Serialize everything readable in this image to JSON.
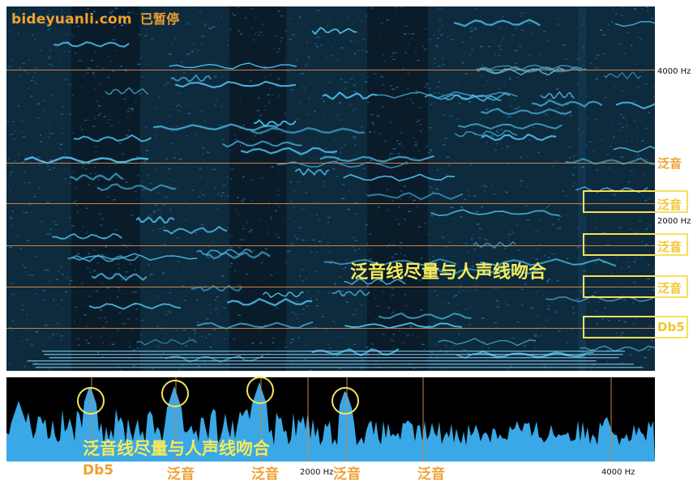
{
  "watermark": {
    "site": "bideyuanli.com",
    "status": "已暂停"
  },
  "spectrogram": {
    "freq_labels": {
      "f4000": "4000 Hz",
      "f2000": "2000 Hz"
    },
    "right_labels": [
      "泛音",
      "泛音",
      "泛音",
      "泛音",
      "Db5"
    ],
    "overlay_text": "泛音线尽量与人声线吻合"
  },
  "spectrum": {
    "overlay_text": "泛音线尽量与人声线吻合",
    "bottom_labels": [
      "Db5",
      "泛音",
      "泛音",
      "泛音",
      "泛音"
    ],
    "freq_labels": {
      "f2000": "2000 Hz",
      "f4000": "4000 Hz"
    }
  },
  "colors": {
    "spectrogram_bg": "#0a1c2a",
    "trace": "#4fc4f2",
    "spectrum_fill": "#3aa8e6",
    "marker_line": "#c8844a",
    "label_orange": "#f0a030",
    "highlight_yellow": "#f4ea5c"
  }
}
